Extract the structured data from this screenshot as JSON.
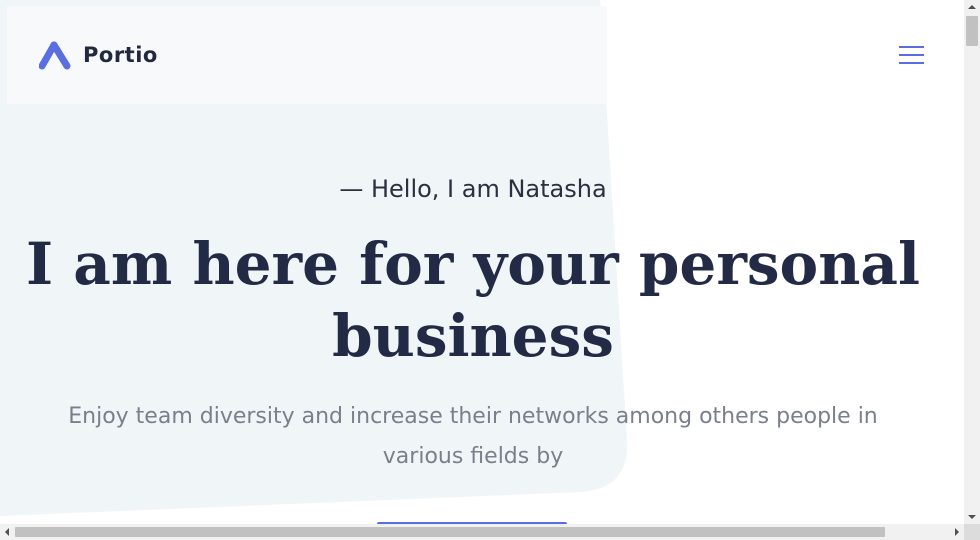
{
  "header": {
    "logo_text": "Portio",
    "logo_icon": "portio-logo-icon",
    "menu_icon": "hamburger-menu-icon"
  },
  "hero": {
    "greeting": "— Hello, I am Natasha",
    "headline_line1": "I am here for your personal",
    "headline_line2": "business",
    "subtext_line1": "Enjoy team diversity and increase their networks among others people in",
    "subtext_line2": "various fields by"
  },
  "colors": {
    "accent": "#5b6ee1",
    "heading": "#222a45",
    "body_text": "#7b7f8c",
    "hero_background": "#f0f5f7",
    "header_background": "#f7f9fa"
  },
  "scrollbars": {
    "vertical": "vertical-scrollbar",
    "horizontal": "horizontal-scrollbar"
  }
}
